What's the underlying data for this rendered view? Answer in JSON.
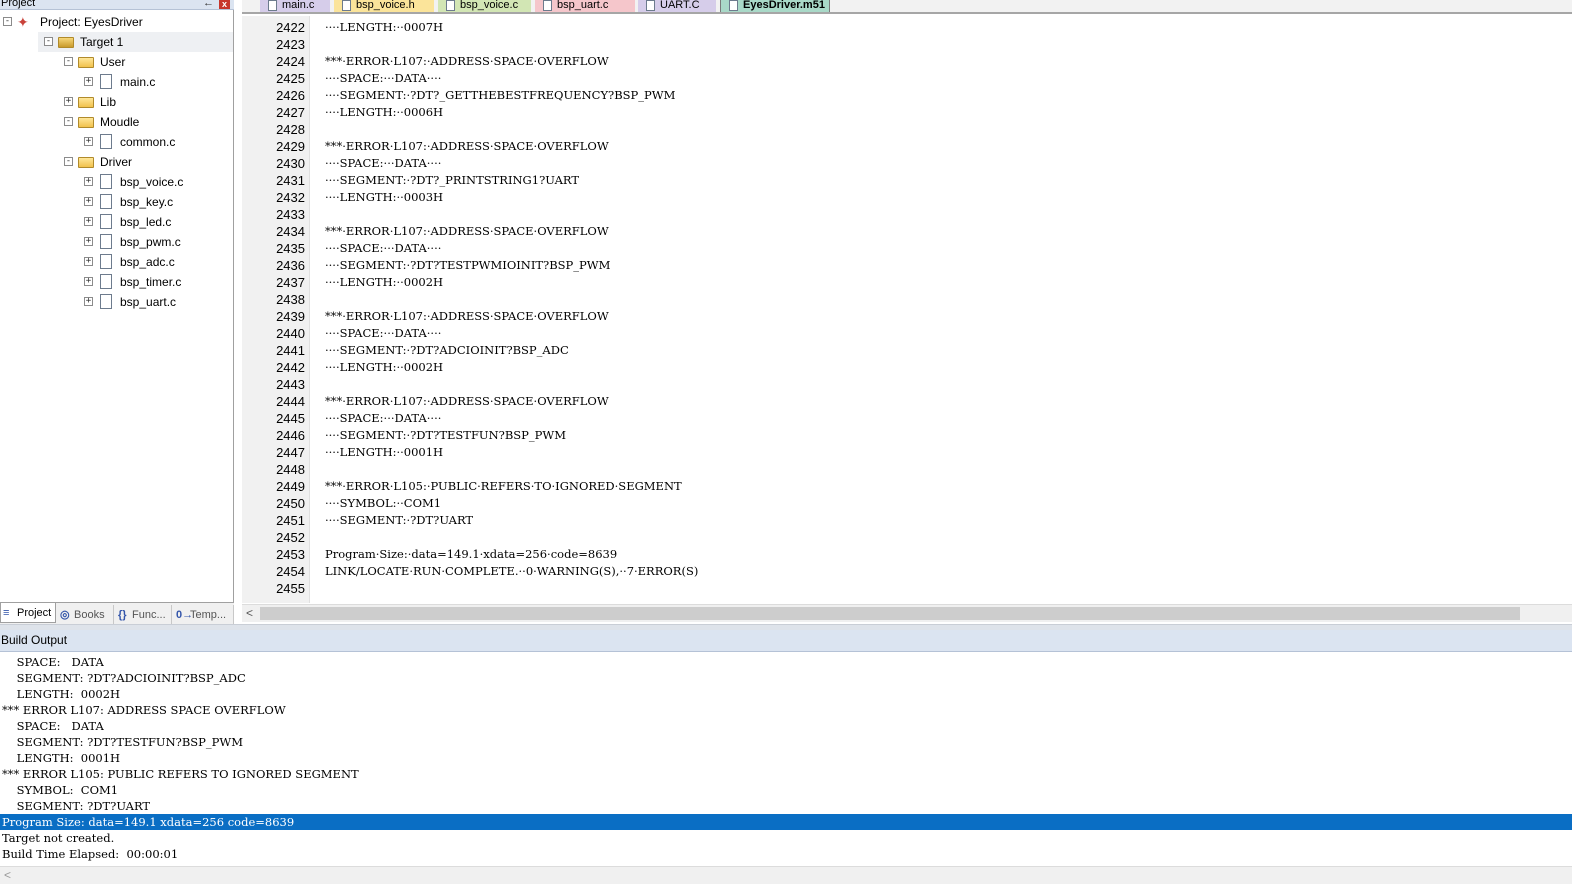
{
  "project_panel": {
    "title": "Project",
    "pin_glyph": "←",
    "close_glyph": "x",
    "tree": [
      {
        "id": "root",
        "label": "Project: EyesDriver",
        "type": "project",
        "exp": "-",
        "depth": 0
      },
      {
        "id": "target1",
        "label": "Target 1",
        "type": "target",
        "exp": "-",
        "depth": 1,
        "selected": true
      },
      {
        "id": "user",
        "label": "User",
        "type": "folder",
        "exp": "-",
        "depth": 2
      },
      {
        "id": "main",
        "label": "main.c",
        "type": "file",
        "exp": "+",
        "depth": 3
      },
      {
        "id": "lib",
        "label": "Lib",
        "type": "folder",
        "exp": "+",
        "depth": 2
      },
      {
        "id": "moudle",
        "label": "Moudle",
        "type": "folder",
        "exp": "-",
        "depth": 2
      },
      {
        "id": "common",
        "label": "common.c",
        "type": "file",
        "exp": "+",
        "depth": 3
      },
      {
        "id": "driver",
        "label": "Driver",
        "type": "folder",
        "exp": "-",
        "depth": 2
      },
      {
        "id": "bsp_voice",
        "label": "bsp_voice.c",
        "type": "file",
        "exp": "+",
        "depth": 3
      },
      {
        "id": "bsp_key",
        "label": "bsp_key.c",
        "type": "file",
        "exp": "+",
        "depth": 3
      },
      {
        "id": "bsp_led",
        "label": "bsp_led.c",
        "type": "file",
        "exp": "+",
        "depth": 3
      },
      {
        "id": "bsp_pwm",
        "label": "bsp_pwm.c",
        "type": "file",
        "exp": "+",
        "depth": 3
      },
      {
        "id": "bsp_adc",
        "label": "bsp_adc.c",
        "type": "file",
        "exp": "+",
        "depth": 3
      },
      {
        "id": "bsp_timer",
        "label": "bsp_timer.c",
        "type": "file",
        "exp": "+",
        "depth": 3
      },
      {
        "id": "bsp_uart",
        "label": "bsp_uart.c",
        "type": "file",
        "exp": "+",
        "depth": 3
      }
    ],
    "bottom_tabs": [
      {
        "label": "Project",
        "glyph": "≡",
        "active": true
      },
      {
        "label": "Books",
        "glyph": "◎",
        "active": false
      },
      {
        "label": "Func...",
        "glyph": "{}",
        "active": false
      },
      {
        "label": "Temp...",
        "glyph": "0→",
        "active": false
      }
    ]
  },
  "editor": {
    "tabs": [
      {
        "label": "main.c",
        "color": "#d6cdea",
        "active": false
      },
      {
        "label": "bsp_voice.h",
        "color": "#fbe49a",
        "active": false
      },
      {
        "label": "bsp_voice.c",
        "color": "#d2e6b4",
        "active": false
      },
      {
        "label": "bsp_uart.c",
        "color": "#f5c6cb",
        "active": false
      },
      {
        "label": "UART.C",
        "color": "#d6cdea",
        "active": false
      },
      {
        "label": "EyesDriver.m51",
        "color": "#a9d9c8",
        "active": true
      }
    ],
    "lines": [
      {
        "n": "2422",
        "t": "····LENGTH:··0007H"
      },
      {
        "n": "2423",
        "t": ""
      },
      {
        "n": "2424",
        "t": "***·ERROR·L107:·ADDRESS·SPACE·OVERFLOW"
      },
      {
        "n": "2425",
        "t": "····SPACE:···DATA····"
      },
      {
        "n": "2426",
        "t": "····SEGMENT:·?DT?_GETTHEBESTFREQUENCY?BSP_PWM"
      },
      {
        "n": "2427",
        "t": "····LENGTH:··0006H"
      },
      {
        "n": "2428",
        "t": ""
      },
      {
        "n": "2429",
        "t": "***·ERROR·L107:·ADDRESS·SPACE·OVERFLOW"
      },
      {
        "n": "2430",
        "t": "····SPACE:···DATA····"
      },
      {
        "n": "2431",
        "t": "····SEGMENT:·?DT?_PRINTSTRING1?UART"
      },
      {
        "n": "2432",
        "t": "····LENGTH:··0003H"
      },
      {
        "n": "2433",
        "t": ""
      },
      {
        "n": "2434",
        "t": "***·ERROR·L107:·ADDRESS·SPACE·OVERFLOW"
      },
      {
        "n": "2435",
        "t": "····SPACE:···DATA····"
      },
      {
        "n": "2436",
        "t": "····SEGMENT:·?DT?TESTPWMIOINIT?BSP_PWM"
      },
      {
        "n": "2437",
        "t": "····LENGTH:··0002H"
      },
      {
        "n": "2438",
        "t": ""
      },
      {
        "n": "2439",
        "t": "***·ERROR·L107:·ADDRESS·SPACE·OVERFLOW"
      },
      {
        "n": "2440",
        "t": "····SPACE:···DATA····"
      },
      {
        "n": "2441",
        "t": "····SEGMENT:·?DT?ADCIOINIT?BSP_ADC"
      },
      {
        "n": "2442",
        "t": "····LENGTH:··0002H"
      },
      {
        "n": "2443",
        "t": ""
      },
      {
        "n": "2444",
        "t": "***·ERROR·L107:·ADDRESS·SPACE·OVERFLOW"
      },
      {
        "n": "2445",
        "t": "····SPACE:···DATA····"
      },
      {
        "n": "2446",
        "t": "····SEGMENT:·?DT?TESTFUN?BSP_PWM"
      },
      {
        "n": "2447",
        "t": "····LENGTH:··0001H"
      },
      {
        "n": "2448",
        "t": ""
      },
      {
        "n": "2449",
        "t": "***·ERROR·L105:·PUBLIC·REFERS·TO·IGNORED·SEGMENT"
      },
      {
        "n": "2450",
        "t": "····SYMBOL:··COM1"
      },
      {
        "n": "2451",
        "t": "····SEGMENT:·?DT?UART"
      },
      {
        "n": "2452",
        "t": ""
      },
      {
        "n": "2453",
        "t": "Program·Size:·data=149.1·xdata=256·code=8639"
      },
      {
        "n": "2454",
        "t": "LINK/LOCATE·RUN·COMPLETE.··0·WARNING(S),··7·ERROR(S)"
      },
      {
        "n": "2455",
        "t": ""
      }
    ],
    "scroll_left_glyph": "<"
  },
  "build_output": {
    "title": "Build Output",
    "lines": [
      {
        "t": "    SPACE:   DATA"
      },
      {
        "t": "    SEGMENT: ?DT?ADCIOINIT?BSP_ADC"
      },
      {
        "t": "    LENGTH:  0002H"
      },
      {
        "t": "*** ERROR L107: ADDRESS SPACE OVERFLOW"
      },
      {
        "t": "    SPACE:   DATA"
      },
      {
        "t": "    SEGMENT: ?DT?TESTFUN?BSP_PWM"
      },
      {
        "t": "    LENGTH:  0001H"
      },
      {
        "t": "*** ERROR L105: PUBLIC REFERS TO IGNORED SEGMENT"
      },
      {
        "t": "    SYMBOL:  COM1"
      },
      {
        "t": "    SEGMENT: ?DT?UART"
      },
      {
        "t": "Program Size: data=149.1 xdata=256 code=8639",
        "highlight": true
      },
      {
        "t": "Target not created."
      },
      {
        "t": "Build Time Elapsed:  00:00:01"
      }
    ],
    "scroll_left_glyph": "<"
  }
}
